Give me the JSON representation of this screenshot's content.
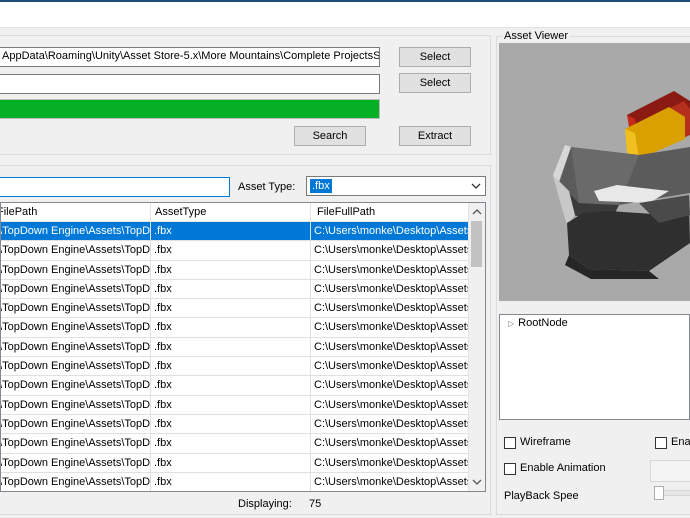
{
  "window": {
    "title": ""
  },
  "top": {
    "path_value": "AppData\\Roaming\\Unity\\Asset Store-5.x\\More Mountains\\Complete ProjectsSystems\\Top",
    "second_value": "",
    "select_label_1": "Select",
    "select_label_2": "Select",
    "progress_percent": 100,
    "search_label": "Search",
    "extract_label": "Extract"
  },
  "filter": {
    "filter_value": "",
    "asset_type_label": "Asset Type:",
    "asset_type_value": ".fbx"
  },
  "grid": {
    "columns": [
      "FilePath",
      "AssetType",
      "FileFullPath"
    ],
    "rows": [
      [
        ".\\TopDown Engine\\Assets\\TopD...",
        ".fbx",
        "C:\\Users\\monke\\Desktop\\Assets\\..."
      ],
      [
        ".\\TopDown Engine\\Assets\\TopD...",
        ".fbx",
        "C:\\Users\\monke\\Desktop\\Assets\\..."
      ],
      [
        ".\\TopDown Engine\\Assets\\TopD...",
        ".fbx",
        "C:\\Users\\monke\\Desktop\\Assets\\..."
      ],
      [
        ".\\TopDown Engine\\Assets\\TopD...",
        ".fbx",
        "C:\\Users\\monke\\Desktop\\Assets\\..."
      ],
      [
        ".\\TopDown Engine\\Assets\\TopD...",
        ".fbx",
        "C:\\Users\\monke\\Desktop\\Assets\\..."
      ],
      [
        ".\\TopDown Engine\\Assets\\TopD...",
        ".fbx",
        "C:\\Users\\monke\\Desktop\\Assets\\..."
      ],
      [
        ".\\TopDown Engine\\Assets\\TopD...",
        ".fbx",
        "C:\\Users\\monke\\Desktop\\Assets\\..."
      ],
      [
        ".\\TopDown Engine\\Assets\\TopD...",
        ".fbx",
        "C:\\Users\\monke\\Desktop\\Assets\\..."
      ],
      [
        ".\\TopDown Engine\\Assets\\TopD...",
        ".fbx",
        "C:\\Users\\monke\\Desktop\\Assets\\..."
      ],
      [
        ".\\TopDown Engine\\Assets\\TopD...",
        ".fbx",
        "C:\\Users\\monke\\Desktop\\Assets\\..."
      ],
      [
        ".\\TopDown Engine\\Assets\\TopD...",
        ".fbx",
        "C:\\Users\\monke\\Desktop\\Assets\\..."
      ],
      [
        ".\\TopDown Engine\\Assets\\TopD...",
        ".fbx",
        "C:\\Users\\monke\\Desktop\\Assets\\..."
      ],
      [
        ".\\TopDown Engine\\Assets\\TopD...",
        ".fbx",
        "C:\\Users\\monke\\Desktop\\Assets\\..."
      ],
      [
        ".\\TopDown Engine\\Assets\\TopD...",
        ".fbx",
        "C:\\Users\\monke\\Desktop\\Assets\\..."
      ]
    ],
    "selected_row": 0
  },
  "status": {
    "displaying_label": "Displaying:",
    "displaying_count": "75"
  },
  "viewer": {
    "group_label": "Asset Viewer",
    "tree_root": "RootNode",
    "wireframe_label": "Wireframe",
    "enable_animation_label": "Enable Animation",
    "enable_right_label": "Ena",
    "playback_speed_label": "PlayBack Spee"
  },
  "colors": {
    "progress": "#06b025",
    "selection": "#0078d7"
  },
  "icons": {
    "tree_expand": "triangle-right-icon",
    "combo_arrow": "chevron-down-icon",
    "scroll_up": "chevron-up-icon",
    "scroll_down": "chevron-down-icon"
  }
}
